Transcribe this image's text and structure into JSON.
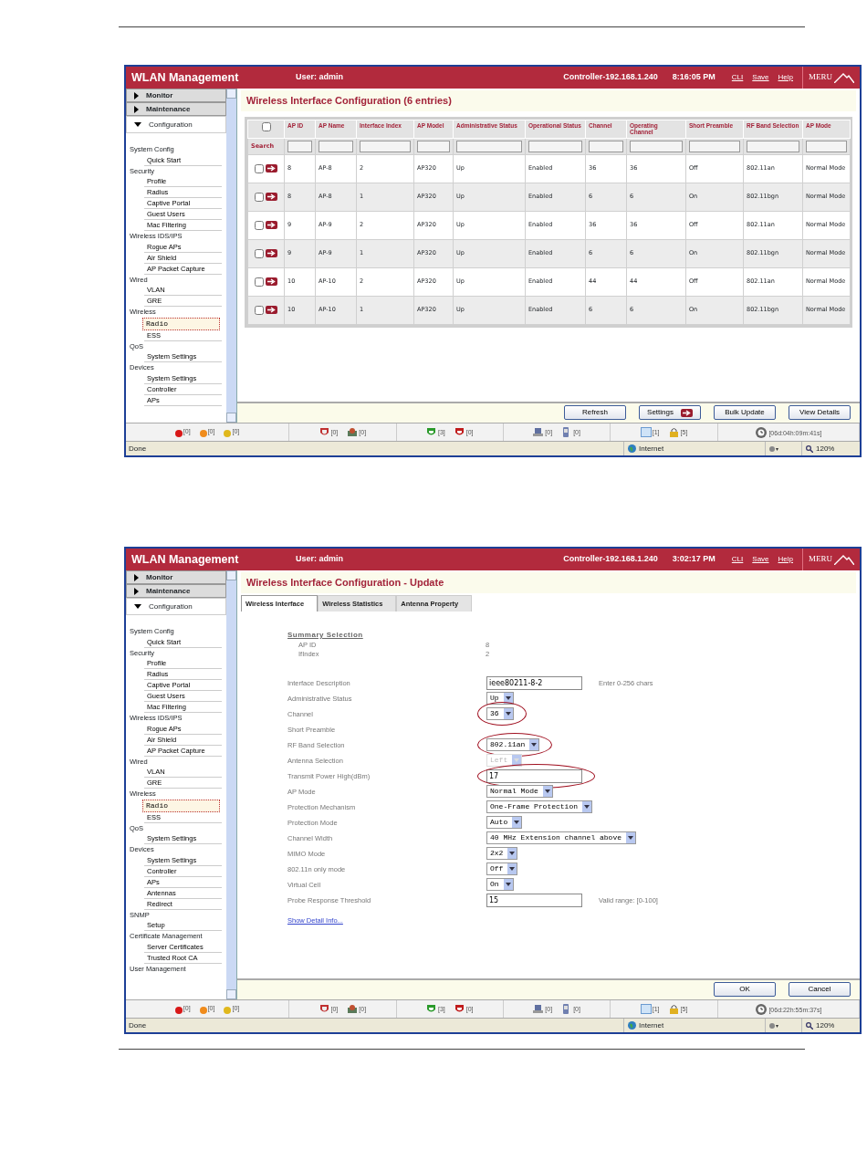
{
  "screenshots": [
    {
      "header": {
        "title": "WLAN Management",
        "user": "User: admin",
        "controller": "Controller-192.168.1.240",
        "time": "8:16:05 PM",
        "links": [
          "CLI",
          "Save",
          "Help"
        ],
        "logo": "MERU"
      },
      "nav": {
        "menus": [
          {
            "label": "Monitor",
            "expanded": false
          },
          {
            "label": "Maintenance",
            "expanded": false
          },
          {
            "label": "Configuration",
            "expanded": true
          }
        ],
        "sections": [
          {
            "label": "System Config",
            "items": [
              {
                "label": "Quick Start",
                "selected": false
              }
            ]
          },
          {
            "label": "Security",
            "items": [
              {
                "label": "Profile",
                "selected": false
              },
              {
                "label": "Radius",
                "selected": false
              },
              {
                "label": "Captive Portal",
                "selected": false
              },
              {
                "label": "Guest Users",
                "selected": false
              },
              {
                "label": "Mac Filtering",
                "selected": false
              }
            ]
          },
          {
            "label": "Wireless IDS/IPS",
            "items": [
              {
                "label": "Rogue APs",
                "selected": false
              },
              {
                "label": "Air Shield",
                "selected": false
              },
              {
                "label": "AP Packet Capture",
                "selected": false
              }
            ]
          },
          {
            "label": "Wired",
            "items": [
              {
                "label": "VLAN",
                "selected": false
              },
              {
                "label": "GRE",
                "selected": false
              }
            ]
          },
          {
            "label": "Wireless",
            "items": [
              {
                "label": "Radio",
                "selected": true
              },
              {
                "label": "ESS",
                "selected": false
              }
            ]
          },
          {
            "label": "QoS",
            "items": [
              {
                "label": "System Settings",
                "selected": false
              }
            ]
          },
          {
            "label": "Devices",
            "items": [
              {
                "label": "System Settings",
                "selected": false
              },
              {
                "label": "Controller",
                "selected": false
              },
              {
                "label": "APs",
                "selected": false
              }
            ]
          }
        ]
      },
      "content": {
        "kind": "table",
        "title": "Wireless Interface Configuration (6 entries)",
        "search_label": "Search",
        "select_all_checked": false,
        "table": {
          "columns": [
            "AP ID",
            "AP Name",
            "Interface Index",
            "AP Model",
            "Administrative Status",
            "Operational Status",
            "Channel",
            "Operating Channel",
            "Short Preamble",
            "RF Band Selection",
            "AP Mode"
          ],
          "rows": [
            {
              "checked": false,
              "cells": [
                "8",
                "AP-8",
                "2",
                "AP320",
                "Up",
                "Enabled",
                "36",
                "36",
                "Off",
                "802.11an",
                "Normal Mode"
              ]
            },
            {
              "checked": false,
              "cells": [
                "8",
                "AP-8",
                "1",
                "AP320",
                "Up",
                "Enabled",
                "6",
                "6",
                "On",
                "802.11bgn",
                "Normal Mode"
              ]
            },
            {
              "checked": false,
              "cells": [
                "9",
                "AP-9",
                "2",
                "AP320",
                "Up",
                "Enabled",
                "36",
                "36",
                "Off",
                "802.11an",
                "Normal Mode"
              ]
            },
            {
              "checked": false,
              "cells": [
                "9",
                "AP-9",
                "1",
                "AP320",
                "Up",
                "Enabled",
                "6",
                "6",
                "On",
                "802.11bgn",
                "Normal Mode"
              ]
            },
            {
              "checked": false,
              "cells": [
                "10",
                "AP-10",
                "2",
                "AP320",
                "Up",
                "Enabled",
                "44",
                "44",
                "Off",
                "802.11an",
                "Normal Mode"
              ]
            },
            {
              "checked": false,
              "cells": [
                "10",
                "AP-10",
                "1",
                "AP320",
                "Up",
                "Enabled",
                "6",
                "6",
                "On",
                "802.11bgn",
                "Normal Mode"
              ]
            }
          ]
        },
        "buttons": [
          {
            "label": "Refresh",
            "arrow": false
          },
          {
            "label": "Settings",
            "arrow": true
          },
          {
            "label": "Bulk Update",
            "arrow": false
          },
          {
            "label": "View Details",
            "arrow": false
          }
        ]
      },
      "status_bar": {
        "groups": [
          [
            {
              "kind": "dot",
              "color": "#d81818",
              "count": "[0]"
            },
            {
              "kind": "dot",
              "color": "#f08c1c",
              "count": "[0]"
            },
            {
              "kind": "dot",
              "color": "#e0b81c",
              "count": "[0]"
            }
          ],
          [
            {
              "kind": "shield",
              "count": "[0]"
            },
            {
              "kind": "ap",
              "count": "[0]"
            }
          ],
          [
            {
              "kind": "up",
              "count": "[3]"
            },
            {
              "kind": "down",
              "count": "[0]"
            }
          ],
          [
            {
              "kind": "laptop",
              "count": "[0]"
            },
            {
              "kind": "phone",
              "count": "[0]"
            }
          ],
          [
            {
              "kind": "screen",
              "count": "[1]"
            },
            {
              "kind": "lock",
              "count": "[5]"
            }
          ],
          [
            {
              "kind": "clock",
              "count": "[06d:04h:09m:41s]"
            }
          ]
        ]
      },
      "browser_status": {
        "status": "Done",
        "zone": "Internet",
        "zoom": "120%"
      }
    },
    {
      "header": {
        "title": "WLAN Management",
        "user": "User: admin",
        "controller": "Controller-192.168.1.240",
        "time": "3:02:17 PM",
        "links": [
          "CLI",
          "Save",
          "Help"
        ],
        "logo": "MERU"
      },
      "nav": {
        "menus": [
          {
            "label": "Monitor",
            "expanded": false
          },
          {
            "label": "Maintenance",
            "expanded": false
          },
          {
            "label": "Configuration",
            "expanded": true
          }
        ],
        "sections": [
          {
            "label": "System Config",
            "items": [
              {
                "label": "Quick Start",
                "selected": false
              }
            ]
          },
          {
            "label": "Security",
            "items": [
              {
                "label": "Profile",
                "selected": false
              },
              {
                "label": "Radius",
                "selected": false
              },
              {
                "label": "Captive Portal",
                "selected": false
              },
              {
                "label": "Guest Users",
                "selected": false
              },
              {
                "label": "Mac Filtering",
                "selected": false
              }
            ]
          },
          {
            "label": "Wireless IDS/IPS",
            "items": [
              {
                "label": "Rogue APs",
                "selected": false
              },
              {
                "label": "Air Shield",
                "selected": false
              },
              {
                "label": "AP Packet Capture",
                "selected": false
              }
            ]
          },
          {
            "label": "Wired",
            "items": [
              {
                "label": "VLAN",
                "selected": false
              },
              {
                "label": "GRE",
                "selected": false
              }
            ]
          },
          {
            "label": "Wireless",
            "items": [
              {
                "label": "Radio",
                "selected": true
              },
              {
                "label": "ESS",
                "selected": false
              }
            ]
          },
          {
            "label": "QoS",
            "items": [
              {
                "label": "System Settings",
                "selected": false
              }
            ]
          },
          {
            "label": "Devices",
            "items": [
              {
                "label": "System Settings",
                "selected": false
              },
              {
                "label": "Controller",
                "selected": false
              },
              {
                "label": "APs",
                "selected": false
              },
              {
                "label": "Antennas",
                "selected": false
              },
              {
                "label": "Redirect",
                "selected": false
              }
            ]
          },
          {
            "label": "SNMP",
            "items": [
              {
                "label": "Setup",
                "selected": false
              }
            ]
          },
          {
            "label": "Certificate Management",
            "items": [
              {
                "label": "Server Certificates",
                "selected": false
              },
              {
                "label": "Trusted Root CA",
                "selected": false
              }
            ]
          },
          {
            "label": "User Management"
          }
        ]
      },
      "content": {
        "kind": "form",
        "title": "Wireless Interface Configuration - Update",
        "tabs": [
          {
            "label": "Wireless Interface",
            "selected": true
          },
          {
            "label": "Wireless Statistics",
            "selected": false
          },
          {
            "label": "Antenna Property",
            "selected": false
          }
        ],
        "summary": {
          "title": "Summary Selection",
          "items": [
            {
              "label": "AP ID",
              "value": "8"
            },
            {
              "label": "IfIndex",
              "value": "2"
            }
          ]
        },
        "fields": [
          {
            "label": "Interface Description",
            "kind": "text",
            "value": "ieee80211-8-2",
            "hint": "Enter 0-256 chars",
            "circled": false
          },
          {
            "label": "Administrative Status",
            "kind": "select",
            "value": "Up",
            "disabled": false,
            "circled": false
          },
          {
            "label": "Channel",
            "kind": "select",
            "value": "36",
            "disabled": false,
            "circled": true
          },
          {
            "label": "Short Preamble",
            "kind": "blank",
            "circled": false
          },
          {
            "label": "RF Band Selection",
            "kind": "select",
            "value": "802.11an",
            "disabled": false,
            "circled": true
          },
          {
            "label": "Antenna Selection",
            "kind": "select",
            "value": "Left",
            "disabled": true,
            "circled": false
          },
          {
            "label": "Transmit Power High(dBm)",
            "kind": "text",
            "value": "17",
            "circled": true
          },
          {
            "label": "AP Mode",
            "kind": "select",
            "value": "Normal Mode",
            "disabled": false,
            "circled": false
          },
          {
            "label": "Protection Mechanism",
            "kind": "select",
            "value": "One-Frame Protection",
            "disabled": false,
            "circled": false
          },
          {
            "label": "Protection Mode",
            "kind": "select",
            "value": "Auto",
            "disabled": false,
            "circled": false
          },
          {
            "label": "Channel Width",
            "kind": "select",
            "value": "40 MHz Extension channel above",
            "disabled": false,
            "circled": false
          },
          {
            "label": "MIMO Mode",
            "kind": "select",
            "value": "2x2",
            "disabled": false,
            "circled": false
          },
          {
            "label": "802.11n only mode",
            "kind": "select",
            "value": "Off",
            "disabled": false,
            "circled": false
          },
          {
            "label": "Virtual Cell",
            "kind": "select",
            "value": "On",
            "disabled": false,
            "circled": false
          },
          {
            "label": "Probe Response Threshold",
            "kind": "text",
            "value": "15",
            "hint": "Valid range: [0-100]",
            "circled": false
          }
        ],
        "link": "Show Detail Info...",
        "buttons": [
          {
            "label": "OK",
            "arrow": false
          },
          {
            "label": "Cancel",
            "arrow": false
          }
        ]
      },
      "status_bar": {
        "groups": [
          [
            {
              "kind": "dot",
              "color": "#d81818",
              "count": "[0]"
            },
            {
              "kind": "dot",
              "color": "#f08c1c",
              "count": "[0]"
            },
            {
              "kind": "dot",
              "color": "#e0b81c",
              "count": "[0]"
            }
          ],
          [
            {
              "kind": "shield",
              "count": "[0]"
            },
            {
              "kind": "ap",
              "count": "[0]"
            }
          ],
          [
            {
              "kind": "up",
              "count": "[3]"
            },
            {
              "kind": "down",
              "count": "[0]"
            }
          ],
          [
            {
              "kind": "laptop",
              "count": "[0]"
            },
            {
              "kind": "phone",
              "count": "[0]"
            }
          ],
          [
            {
              "kind": "screen",
              "count": "[1]"
            },
            {
              "kind": "lock",
              "count": "[5]"
            }
          ],
          [
            {
              "kind": "clock",
              "count": "[06d:22h:55m:37s]"
            }
          ]
        ]
      },
      "browser_status": {
        "status": "Done",
        "zone": "Internet",
        "zoom": "120%"
      }
    }
  ]
}
